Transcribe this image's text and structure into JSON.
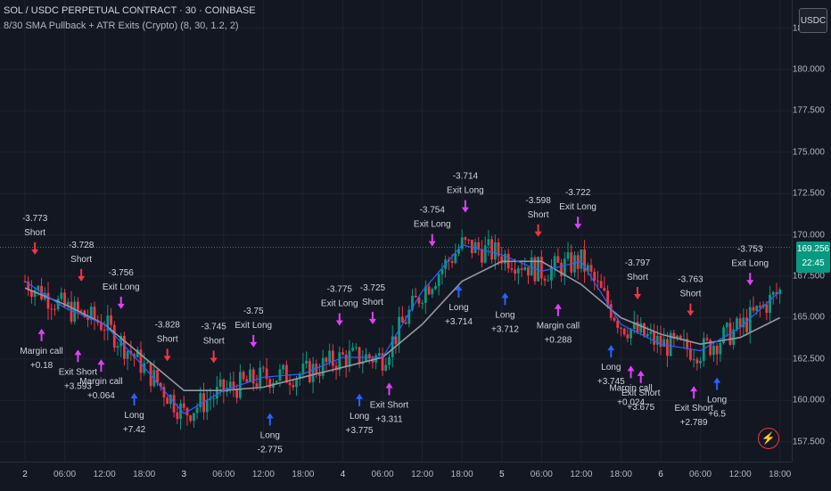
{
  "header": {
    "symbol_title": "SOL / USDC PERPETUAL CONTRACT · 30 · COINBASE",
    "strategy_title": "8/30 SMA Pullback + ATR Exits (Crypto) (8, 30, 1.2, 2)",
    "currency": "USDC"
  },
  "price_scale": {
    "ticks": [
      "157.500",
      "160.000",
      "162.500",
      "165.000",
      "167.500",
      "170.000",
      "172.500",
      "175.000",
      "177.500",
      "180.000",
      "182.500"
    ],
    "last_price": "169.256",
    "countdown": "22:45"
  },
  "time_scale": {
    "ticks": [
      "2",
      "06:00",
      "12:00",
      "18:00",
      "3",
      "06:00",
      "12:00",
      "18:00",
      "4",
      "06:00",
      "12:00",
      "18:00",
      "5",
      "06:00",
      "12:00",
      "18:00",
      "6",
      "06:00",
      "12:00",
      "18:00"
    ]
  },
  "colors": {
    "background": "#131722",
    "up": "#089981",
    "down": "#f23645",
    "fast_sma": "#2962ff",
    "slow_sma": "#9598a1",
    "entry_long": "#2962ff",
    "entry_short": "#f23645",
    "exit_marker": "#e040fb"
  },
  "icons": {
    "flash": "lightning-icon"
  },
  "chart_data": {
    "type": "candlestick",
    "ylim": [
      156.3,
      184.2
    ],
    "x_start": "2",
    "x_end": "6 18:00",
    "x_unit": "hours",
    "fast_sma": [
      [
        0,
        167.2
      ],
      [
        6,
        165.6
      ],
      [
        12,
        164.6
      ],
      [
        18,
        162.0
      ],
      [
        24,
        159.2
      ],
      [
        30,
        160.6
      ],
      [
        36,
        161.4
      ],
      [
        42,
        161.6
      ],
      [
        48,
        162.6
      ],
      [
        54,
        162.6
      ],
      [
        60,
        166.6
      ],
      [
        66,
        169.4
      ],
      [
        72,
        168.8
      ],
      [
        78,
        167.8
      ],
      [
        84,
        168.4
      ],
      [
        90,
        164.6
      ],
      [
        96,
        163.4
      ],
      [
        102,
        163.0
      ],
      [
        108,
        164.4
      ],
      [
        114,
        166.6
      ]
    ],
    "slow_sma": [
      [
        0,
        166.8
      ],
      [
        6,
        165.8
      ],
      [
        12,
        164.6
      ],
      [
        18,
        162.6
      ],
      [
        24,
        160.6
      ],
      [
        30,
        160.6
      ],
      [
        36,
        160.8
      ],
      [
        42,
        161.4
      ],
      [
        48,
        162.0
      ],
      [
        54,
        162.6
      ],
      [
        60,
        164.6
      ],
      [
        66,
        167.2
      ],
      [
        72,
        168.4
      ],
      [
        78,
        168.4
      ],
      [
        84,
        167.0
      ],
      [
        90,
        165.0
      ],
      [
        96,
        164.0
      ],
      [
        102,
        163.4
      ],
      [
        108,
        163.8
      ],
      [
        114,
        165.0
      ]
    ],
    "trades": [
      {
        "t": 1.5,
        "side": "short",
        "labels": [
          "-3.773",
          "Short"
        ]
      },
      {
        "t": 8.5,
        "side": "short",
        "labels": [
          "-3.728",
          "Short"
        ]
      },
      {
        "t": 14.5,
        "side": "exit",
        "labels": [
          "-3.756",
          "Exit Long"
        ]
      },
      {
        "t": 21.5,
        "side": "short",
        "labels": [
          "-3.828",
          "Short"
        ]
      },
      {
        "t": 28.5,
        "side": "short",
        "labels": [
          "-3.745",
          "Short"
        ]
      },
      {
        "t": 34.5,
        "side": "exit",
        "labels": [
          "-3.75",
          "Exit Long"
        ]
      },
      {
        "t": 47.5,
        "side": "exit",
        "labels": [
          "-3.775",
          "Exit Long"
        ]
      },
      {
        "t": 52.5,
        "side": "exit",
        "labels": [
          "-3.725",
          "Short"
        ]
      },
      {
        "t": 61.5,
        "side": "exit",
        "labels": [
          "-3.754",
          "Exit Long"
        ]
      },
      {
        "t": 66.5,
        "side": "exit",
        "labels": [
          "-3.714",
          "Exit Long"
        ]
      },
      {
        "t": 77.5,
        "side": "short",
        "labels": [
          "-3.598",
          "Short"
        ]
      },
      {
        "t": 83.5,
        "side": "exit",
        "labels": [
          "-3.722",
          "Exit Long"
        ]
      },
      {
        "t": 92.5,
        "side": "short",
        "labels": [
          "-3.797",
          "Short"
        ]
      },
      {
        "t": 100.5,
        "side": "short",
        "labels": [
          "-3.763",
          "Short"
        ]
      },
      {
        "t": 109.5,
        "side": "exit",
        "labels": [
          "-3.753",
          "Exit Long"
        ]
      },
      {
        "t": 2.5,
        "side": "exit",
        "labels": [
          "Margin call",
          "+0.18"
        ]
      },
      {
        "t": 8.0,
        "side": "exit",
        "labels": [
          "Exit Short",
          "+3.593"
        ]
      },
      {
        "t": 11.5,
        "side": "exit",
        "labels": [
          "Margin call",
          "+0.064"
        ]
      },
      {
        "t": 16.5,
        "side": "long",
        "labels": [
          "Long",
          "+7.42"
        ]
      },
      {
        "t": 37.0,
        "side": "long",
        "labels": [
          "Long",
          "-2.775"
        ]
      },
      {
        "t": 50.5,
        "side": "long",
        "labels": [
          "Long",
          "+3.775"
        ]
      },
      {
        "t": 55.0,
        "side": "exit",
        "labels": [
          "Exit Short",
          "+3.311"
        ]
      },
      {
        "t": 65.5,
        "side": "long",
        "labels": [
          "Long",
          "+3.714"
        ]
      },
      {
        "t": 72.5,
        "side": "long",
        "labels": [
          "Long",
          "+3.712"
        ]
      },
      {
        "t": 80.5,
        "side": "exit",
        "labels": [
          "Margin call",
          "+0.288"
        ]
      },
      {
        "t": 88.5,
        "side": "long",
        "labels": [
          "Long",
          "+3.745"
        ]
      },
      {
        "t": 91.5,
        "side": "exit",
        "labels": [
          "Margin call",
          "+0.024"
        ]
      },
      {
        "t": 93.0,
        "side": "exit",
        "labels": [
          "Exit Short",
          "+3.675"
        ]
      },
      {
        "t": 101.0,
        "side": "exit",
        "labels": [
          "Exit Short",
          "+2.789"
        ]
      },
      {
        "t": 104.5,
        "side": "long",
        "labels": [
          "Long",
          "+6.5"
        ]
      }
    ]
  }
}
